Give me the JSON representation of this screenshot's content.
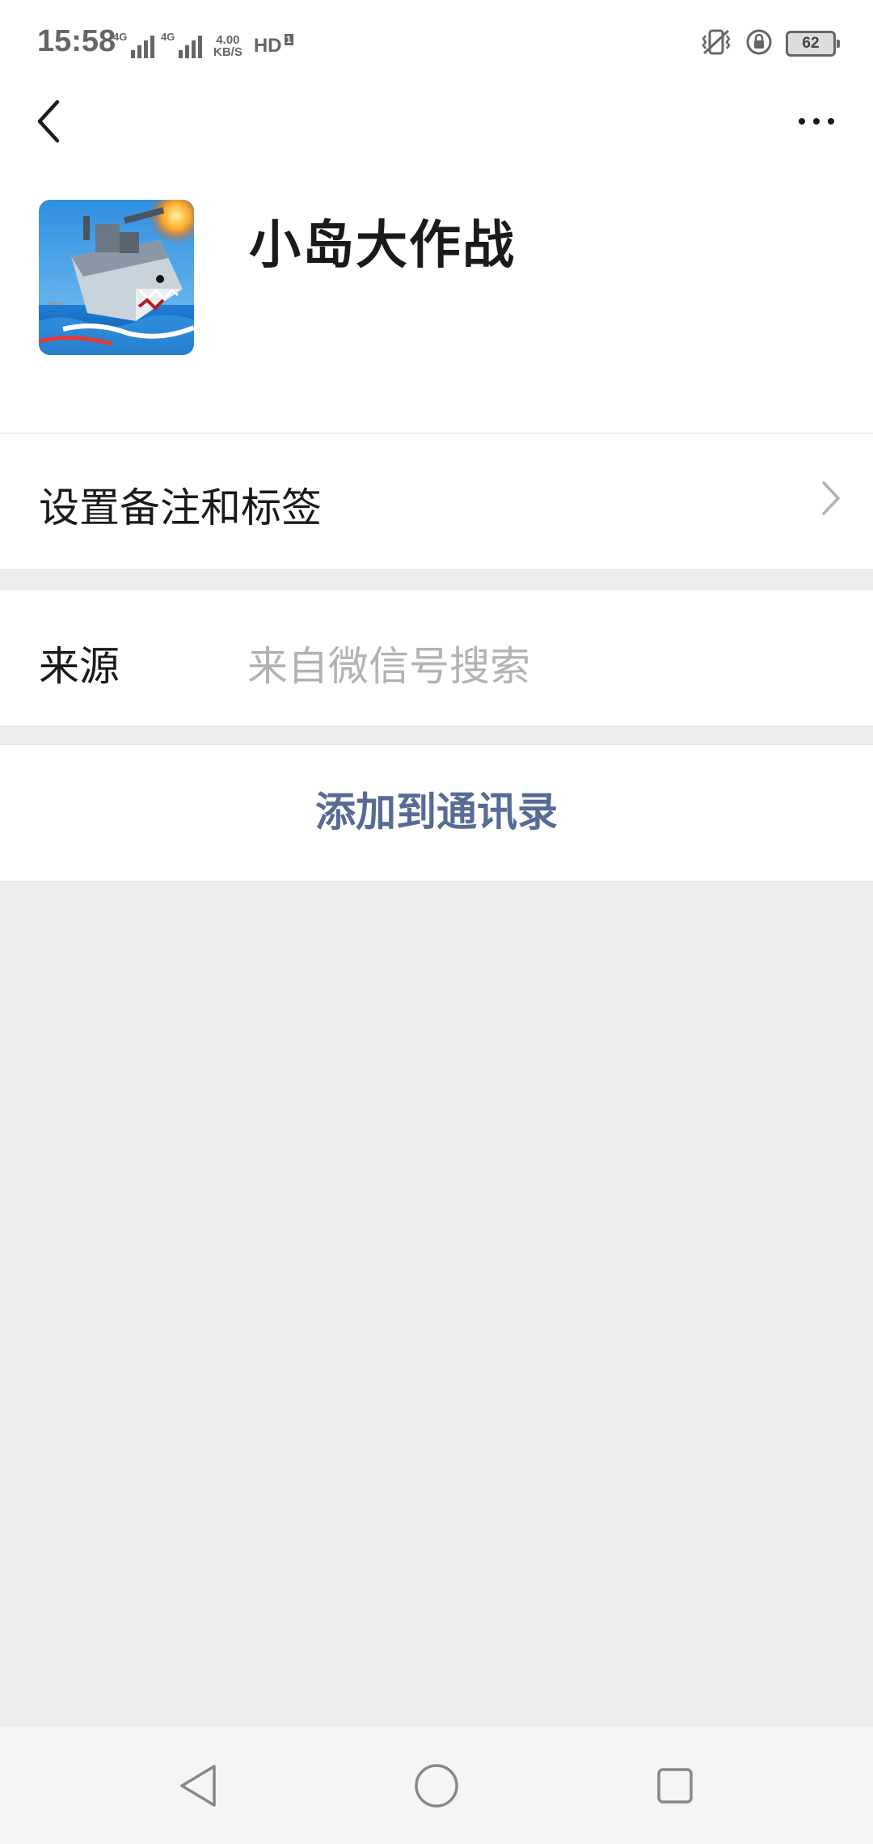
{
  "status_bar": {
    "time": "15:58",
    "network_1": "4G",
    "network_2": "4G",
    "speed_value": "4.00",
    "speed_unit": "KB/S",
    "hd_label": "HD",
    "battery": "62",
    "icons": [
      "signal-icon",
      "signal-icon",
      "hd-voice-icon",
      "vibrate-icon",
      "rotation-lock-icon",
      "battery-icon"
    ]
  },
  "top_nav": {
    "back_icon": "back-arrow-icon",
    "more_icon": "more-dots-icon"
  },
  "profile": {
    "name": "小岛大作战",
    "avatar": "battleship-game-icon"
  },
  "remark_row": {
    "label": "设置备注和标签",
    "icon": "chevron-right-icon"
  },
  "source_row": {
    "label": "来源",
    "value": "来自微信号搜索"
  },
  "actions": {
    "add_contact": "添加到通讯录"
  },
  "colors": {
    "link": "#576b95",
    "background": "#ededed",
    "secondary_text": "#b2b2b2"
  },
  "system_nav": {
    "icons": [
      "back-triangle-icon",
      "home-circle-icon",
      "recents-square-icon"
    ]
  }
}
